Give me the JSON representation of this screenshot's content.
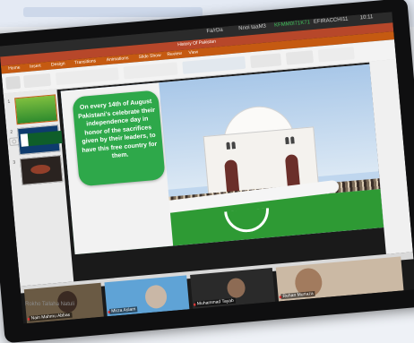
{
  "taskbar": {
    "item1": "Fa/rDa",
    "item2": "Nnoi taaM3",
    "item3": "KFMM0I71K71",
    "item4": "EFIRACCHI11",
    "clock": "10:11"
  },
  "window": {
    "title": "History Of Pakistan"
  },
  "ribbon_tabs": [
    "Home",
    "Insert",
    "Design",
    "Transitions",
    "Animations",
    "Slide Show",
    "Review",
    "View"
  ],
  "slide": {
    "text": "On every 14th of August Pakistani's celebrate their independence day in honor of the sacrifices given by their leaders, to have this free country for them."
  },
  "thumbnails": [
    "1",
    "2",
    "3"
  ],
  "participants": [
    {
      "name": "Nain Mahmu Abbas"
    },
    {
      "name": "Mirza Aslam"
    },
    {
      "name": "Muhammad Tayab"
    },
    {
      "name": "Rehan Murtaza"
    }
  ],
  "caption": "Rokho Tallaha Natuli",
  "colors": {
    "accent": "#c55a11",
    "slide_green": "#2ea84a",
    "lawn": "#2e9a34"
  }
}
